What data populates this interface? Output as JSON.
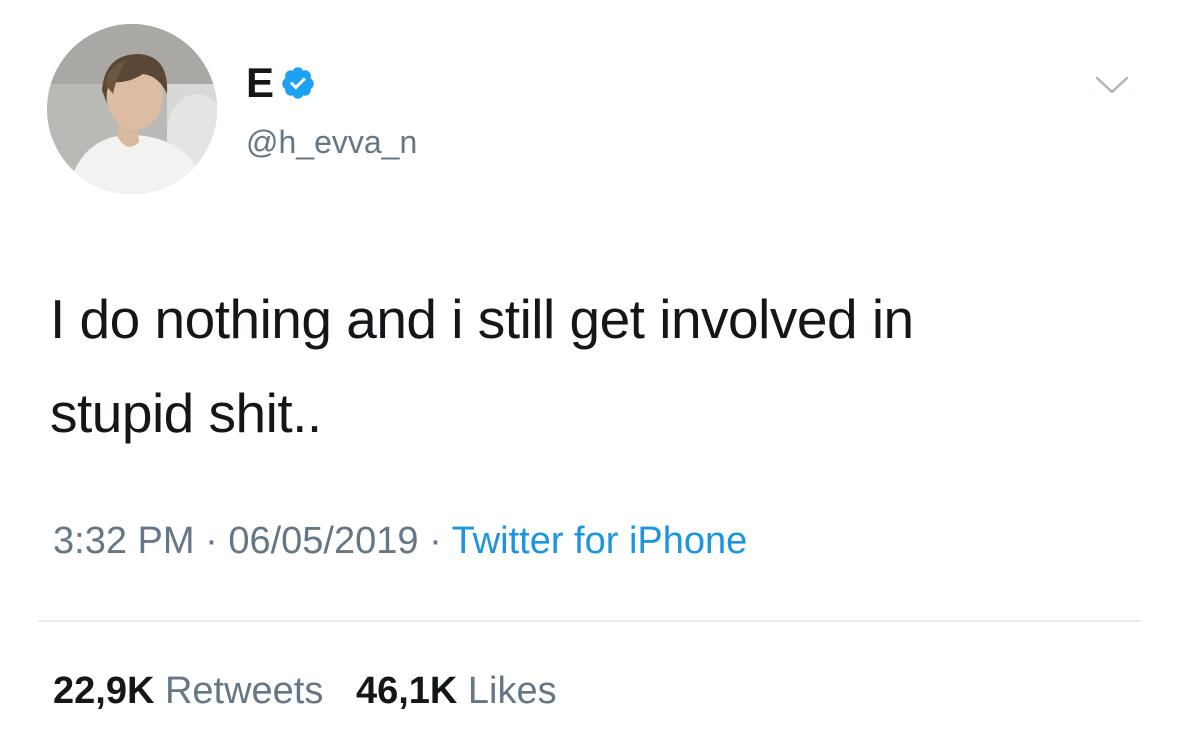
{
  "user": {
    "display_name": "E",
    "handle": "@h_evva_n",
    "verified": true
  },
  "tweet": {
    "text_line1": "I do nothing and i still get involved in",
    "text_line2": "stupid shit..",
    "time": "3:32 PM",
    "date": "06/05/2019",
    "separator": "·",
    "source": "Twitter for iPhone"
  },
  "stats": {
    "retweets_count": "22,9K",
    "retweets_label": "Retweets",
    "likes_count": "46,1K",
    "likes_label": "Likes"
  },
  "icons": {
    "verified": "verified-badge-icon",
    "menu": "chevron-down-icon"
  },
  "colors": {
    "text": "#14171a",
    "secondary": "#657786",
    "link": "#1b95e0",
    "verified": "#1da1f2",
    "divider": "#e6ecf0"
  }
}
